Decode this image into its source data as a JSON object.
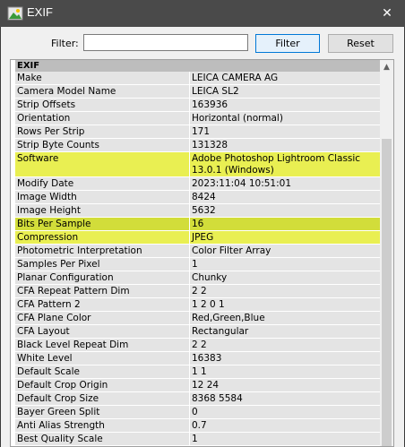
{
  "window": {
    "title": "EXIF",
    "close_symbol": "✕"
  },
  "toolbar": {
    "filter_label": "Filter:",
    "filter_value": "",
    "filter_button": "Filter",
    "reset_button": "Reset"
  },
  "section": "EXIF",
  "rows": [
    {
      "k": "Make",
      "v": "LEICA CAMERA AG",
      "hl": ""
    },
    {
      "k": "Camera Model Name",
      "v": "LEICA SL2",
      "hl": ""
    },
    {
      "k": "Strip Offsets",
      "v": "163936",
      "hl": ""
    },
    {
      "k": "Orientation",
      "v": "Horizontal (normal)",
      "hl": ""
    },
    {
      "k": "Rows Per Strip",
      "v": "171",
      "hl": ""
    },
    {
      "k": "Strip Byte Counts",
      "v": "131328",
      "hl": ""
    },
    {
      "k": "Software",
      "v": "Adobe Photoshop Lightroom Classic\n13.0.1 (Windows)",
      "hl": "hl2",
      "tall": true
    },
    {
      "k": "Modify Date",
      "v": "2023:11:04 10:51:01",
      "hl": ""
    },
    {
      "k": "Image Width",
      "v": "8424",
      "hl": ""
    },
    {
      "k": "Image Height",
      "v": "5632",
      "hl": ""
    },
    {
      "k": "Bits Per Sample",
      "v": "16",
      "hl": "hl"
    },
    {
      "k": "Compression",
      "v": "JPEG",
      "hl": "hl2"
    },
    {
      "k": "Photometric Interpretation",
      "v": "Color Filter Array",
      "hl": ""
    },
    {
      "k": "Samples Per Pixel",
      "v": "1",
      "hl": ""
    },
    {
      "k": "Planar Configuration",
      "v": "Chunky",
      "hl": ""
    },
    {
      "k": "CFA Repeat Pattern Dim",
      "v": "2 2",
      "hl": ""
    },
    {
      "k": "CFA Pattern 2",
      "v": "1 2 0 1",
      "hl": ""
    },
    {
      "k": "CFA Plane Color",
      "v": "Red,Green,Blue",
      "hl": ""
    },
    {
      "k": "CFA Layout",
      "v": "Rectangular",
      "hl": ""
    },
    {
      "k": "Black Level Repeat Dim",
      "v": "2 2",
      "hl": ""
    },
    {
      "k": "White Level",
      "v": "16383",
      "hl": ""
    },
    {
      "k": "Default Scale",
      "v": "1 1",
      "hl": ""
    },
    {
      "k": "Default Crop Origin",
      "v": "12 24",
      "hl": ""
    },
    {
      "k": "Default Crop Size",
      "v": "8368 5584",
      "hl": ""
    },
    {
      "k": "Bayer Green Split",
      "v": "0",
      "hl": ""
    },
    {
      "k": "Anti Alias Strength",
      "v": "0.7",
      "hl": ""
    },
    {
      "k": "Best Quality Scale",
      "v": "1",
      "hl": ""
    }
  ],
  "icons": {
    "app": "image-icon",
    "close": "close-icon",
    "scroll_up": "chevron-up-icon"
  },
  "colors": {
    "titlebar": "#4a4a4a",
    "highlight": "#d2dd3a",
    "highlight_light": "#e9ef52",
    "row_bg": "#e4e4e4"
  }
}
